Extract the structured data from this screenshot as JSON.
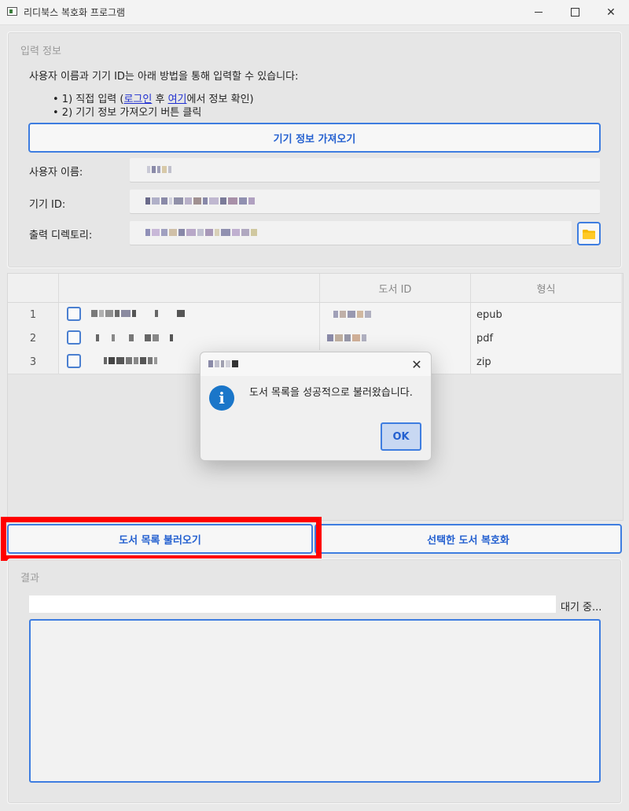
{
  "window": {
    "title": "리디북스 복호화 프로그램"
  },
  "input_group": {
    "title": "입력 정보",
    "instruction": "사용자 이름과 기기 ID는 아래 방법을 통해 입력할 수 있습니다:",
    "bullet1": {
      "prefix": "• 1) 직접 입력 (",
      "login_link": "로그인",
      "middle": " 후 ",
      "here_link": "여기",
      "suffix": "에서 정보 확인)"
    },
    "bullet2": "• 2) 기기 정보 가져오기 버튼 클릭",
    "fetch_button": "기기 정보 가져오기",
    "username_label": "사용자 이름:",
    "device_id_label": "기기 ID:",
    "output_dir_label": "출력 디렉토리:",
    "folder_icon": "folder-icon"
  },
  "table": {
    "headers": [
      "",
      "",
      "도서 ID",
      "형식"
    ],
    "rows": [
      {
        "num": "1",
        "format": "epub"
      },
      {
        "num": "2",
        "format": "pdf"
      },
      {
        "num": "3",
        "format": "zip"
      }
    ]
  },
  "dialog": {
    "message": "도서 목록을 성공적으로 불러왔습니다.",
    "ok_label": "OK",
    "close_glyph": "✕",
    "icon": "info-icon"
  },
  "actions": {
    "load_books": "도서 목록 불러오기",
    "decrypt_selected": "선택한 도서 복호화"
  },
  "result_group": {
    "title": "결과",
    "status": "대기 중..."
  },
  "colors": {
    "accent": "#3e7de0",
    "highlight": "#ff0000",
    "info_icon": "#1a76c9"
  }
}
